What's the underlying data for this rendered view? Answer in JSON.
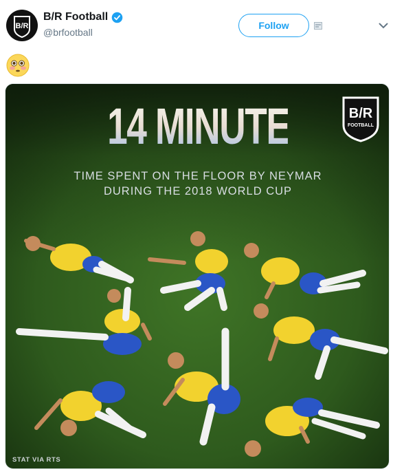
{
  "account": {
    "display_name": "B/R Football",
    "handle": "@brfootball",
    "avatar_text": "B/R",
    "verified": true
  },
  "actions": {
    "follow_label": "Follow"
  },
  "tweet": {
    "emoji": "flushed-face-emoji"
  },
  "graphic": {
    "headline": "14 MINUTES",
    "subtitle_line1": "TIME SPENT ON THE FLOOR BY NEYMAR",
    "subtitle_line2": "DURING THE 2018 WORLD CUP",
    "logo_text": "B/R",
    "logo_subtext": "FOOTBALL",
    "credit": "STAT VIA RTS"
  },
  "colors": {
    "accent": "#1da1f2",
    "grass": "#2f5a1e",
    "jersey": "#f2d22e",
    "shorts": "#2a56c6"
  },
  "icons": {
    "verified": "verified-badge-icon",
    "caret": "chevron-down-icon",
    "media_extra": "media-thumb-icon"
  }
}
